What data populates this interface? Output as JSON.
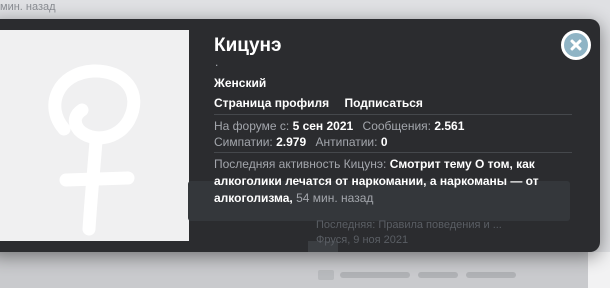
{
  "background": {
    "top_text": "мин. назад",
    "thread_rows": [
      "Последняя: Правила поведения и ...",
      "Фруся, 9 ноя 2021"
    ]
  },
  "profile": {
    "name": "Кицунэ",
    "user_title": ".",
    "gender": "Женский",
    "links": {
      "profile_page": "Страница профиля",
      "follow": "Подписаться"
    },
    "stats": [
      {
        "label": "На форуме с:",
        "value": "5 сен 2021"
      },
      {
        "label": "Сообщения:",
        "value": "2.561"
      },
      {
        "label": "Симпатии:",
        "value": "2.979"
      },
      {
        "label": "Антипатии:",
        "value": "0"
      }
    ],
    "activity": {
      "label": "Последняя активность Кицунэ:",
      "text": "Смотрит тему О том, как алкоголики лечатся от наркомании, а наркоманы — от алкоголизма,",
      "time": "54 мин. назад"
    }
  },
  "colors": {
    "card_bg": "#2b2c2f",
    "close_button": "#8fb4c5",
    "avatar_bg": "#f0f0f1"
  }
}
